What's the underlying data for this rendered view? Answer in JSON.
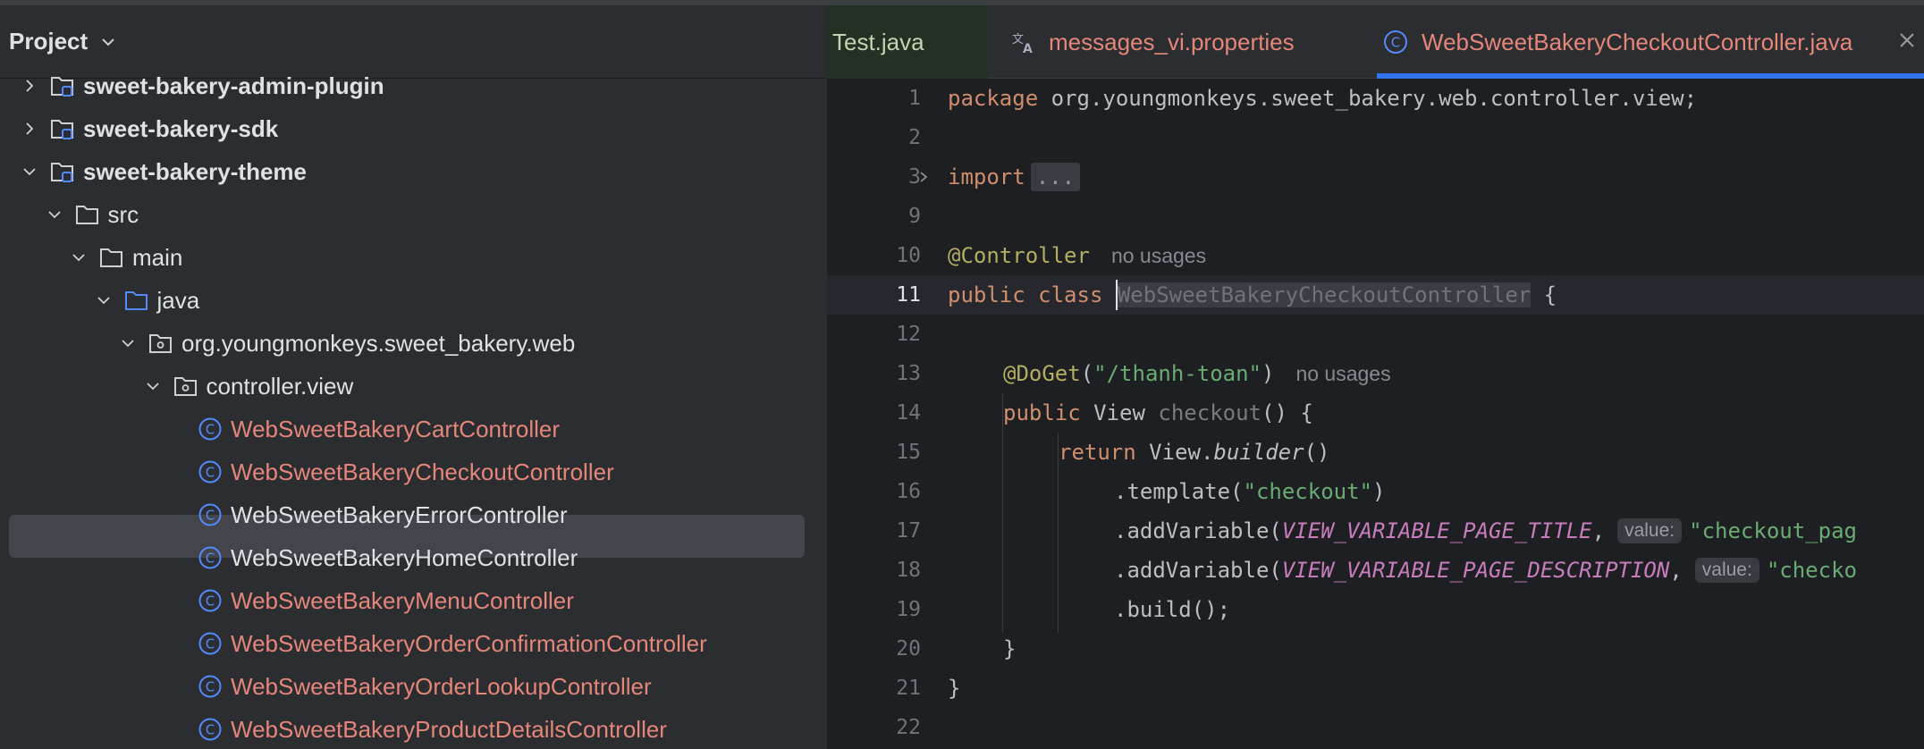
{
  "project_panel": {
    "title": "Project",
    "tree": [
      {
        "label": "sweet-bakery-admin-plugin",
        "depth": 0,
        "arrow": "right",
        "icon": "module-folder-icon",
        "style": "module"
      },
      {
        "label": "sweet-bakery-sdk",
        "depth": 0,
        "arrow": "right",
        "icon": "module-folder-icon",
        "style": "module"
      },
      {
        "label": "sweet-bakery-theme",
        "depth": 0,
        "arrow": "down",
        "icon": "module-folder-icon",
        "style": "module"
      },
      {
        "label": "src",
        "depth": 1,
        "arrow": "down",
        "icon": "folder-icon",
        "style": "normal"
      },
      {
        "label": "main",
        "depth": 2,
        "arrow": "down",
        "icon": "folder-icon",
        "style": "normal"
      },
      {
        "label": "java",
        "depth": 3,
        "arrow": "down",
        "icon": "source-folder-icon",
        "style": "normal"
      },
      {
        "label": "org.youngmonkeys.sweet_bakery.web",
        "depth": 4,
        "arrow": "down",
        "icon": "package-icon",
        "style": "normal"
      },
      {
        "label": "controller.view",
        "depth": 5,
        "arrow": "down",
        "icon": "package-icon",
        "style": "normal"
      },
      {
        "label": "WebSweetBakeryCartController",
        "depth": 6,
        "arrow": "none",
        "icon": "class-icon",
        "style": "modified"
      },
      {
        "label": "WebSweetBakeryCheckoutController",
        "depth": 6,
        "arrow": "none",
        "icon": "class-icon",
        "style": "modified",
        "selected": true
      },
      {
        "label": "WebSweetBakeryErrorController",
        "depth": 6,
        "arrow": "none",
        "icon": "class-icon",
        "style": "normal"
      },
      {
        "label": "WebSweetBakeryHomeController",
        "depth": 6,
        "arrow": "none",
        "icon": "class-icon",
        "style": "normal"
      },
      {
        "label": "WebSweetBakeryMenuController",
        "depth": 6,
        "arrow": "none",
        "icon": "class-icon",
        "style": "modified"
      },
      {
        "label": "WebSweetBakeryOrderConfirmationController",
        "depth": 6,
        "arrow": "none",
        "icon": "class-icon",
        "style": "modified"
      },
      {
        "label": "WebSweetBakeryOrderLookupController",
        "depth": 6,
        "arrow": "none",
        "icon": "class-icon",
        "style": "modified"
      },
      {
        "label": "WebSweetBakeryProductDetailsController",
        "depth": 6,
        "arrow": "none",
        "icon": "class-icon",
        "style": "modified"
      }
    ]
  },
  "editor": {
    "tabs": [
      {
        "label": "Test.java",
        "icon": "none"
      },
      {
        "label": "messages_vi.properties",
        "icon": "translate-icon"
      },
      {
        "label": "WebSweetBakeryCheckoutController.java",
        "icon": "class-icon",
        "active": true
      }
    ],
    "line_numbers": [
      "1",
      "2",
      "3",
      "9",
      "10",
      "11",
      "12",
      "13",
      "14",
      "15",
      "16",
      "17",
      "18",
      "19",
      "20",
      "21",
      "22"
    ],
    "code": {
      "l1_kw": "package",
      "l1_rest": " org.youngmonkeys.sweet_bakery.web.controller.view;",
      "l3_kw": "import",
      "l3_folded": "...",
      "l10_ann": "@Controller",
      "l10_hint": "no usages",
      "l11_kw": "public class ",
      "l11_name": "WebSweetBakeryCheckoutController",
      "l11_rest": " {",
      "l13_ann": "@DoGet",
      "l13_p1": "(",
      "l13_str": "\"/thanh-toan\"",
      "l13_p2": ")",
      "l13_hint": "no usages",
      "l14_kw": "public ",
      "l14_type": "View ",
      "l14_method": "checkout",
      "l14_rest": "() {",
      "l15_kw": "return ",
      "l15_obj": "View.",
      "l15_call": "builder",
      "l15_rest": "()",
      "l16_pre": ".template(",
      "l16_str": "\"checkout\"",
      "l16_post": ")",
      "l17_pre": ".addVariable(",
      "l17_const": "VIEW_VARIABLE_PAGE_TITLE",
      "l17_comma": ",",
      "l17_hint": "value:",
      "l17_str": "\"checkout_pag",
      "l18_pre": ".addVariable(",
      "l18_const": "VIEW_VARIABLE_PAGE_DESCRIPTION",
      "l18_comma": ",",
      "l18_hint": "value:",
      "l18_str": "\"checko",
      "l19": ".build();",
      "l20": "}",
      "l21": "}"
    }
  },
  "colors": {
    "modified_file": "#e4867a",
    "keyword": "#cf8e6d",
    "annotation": "#b3ae60",
    "string": "#6aab73",
    "constant": "#c77dbb",
    "accent": "#3574f0"
  }
}
